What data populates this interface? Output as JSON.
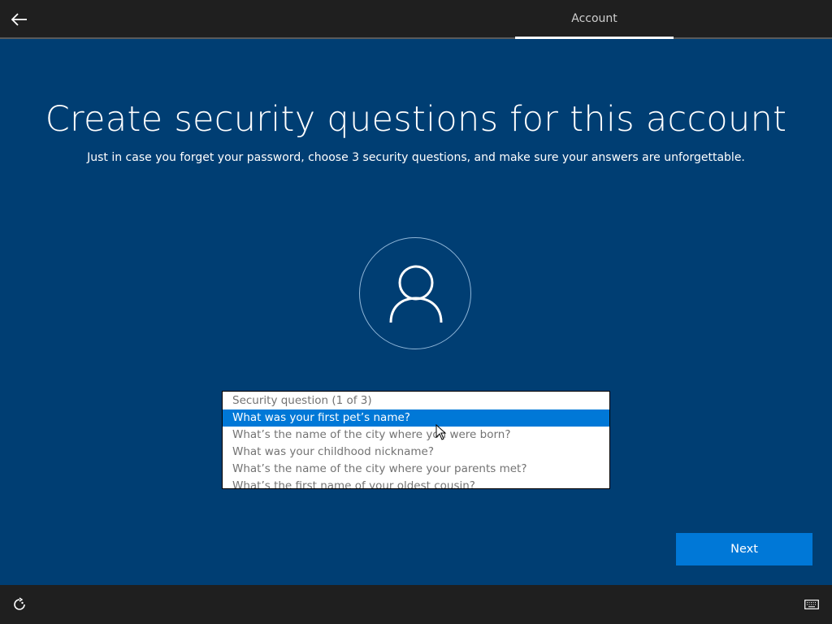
{
  "header": {
    "tab_label": "Account"
  },
  "main": {
    "title": "Create security questions for this account",
    "subtitle": "Just in case you forget your password, choose 3 security questions, and make sure your answers are unforgettable."
  },
  "dropdown": {
    "placeholder": "Security question (1 of 3)",
    "options": [
      "What was your first pet’s name?",
      "What’s the name of the city where you were born?",
      "What was your childhood nickname?",
      "What’s the name of the city where your parents met?",
      "What’s the first name of your oldest cousin?"
    ],
    "highlighted_index": 0
  },
  "actions": {
    "next_label": "Next"
  },
  "icons": {
    "back": "back-arrow-icon",
    "avatar": "user-icon",
    "ease_of_access": "ease-of-access-icon",
    "keyboard": "keyboard-icon"
  },
  "colors": {
    "background": "#003e73",
    "bar": "#1f1f1f",
    "accent": "#0078d7"
  }
}
